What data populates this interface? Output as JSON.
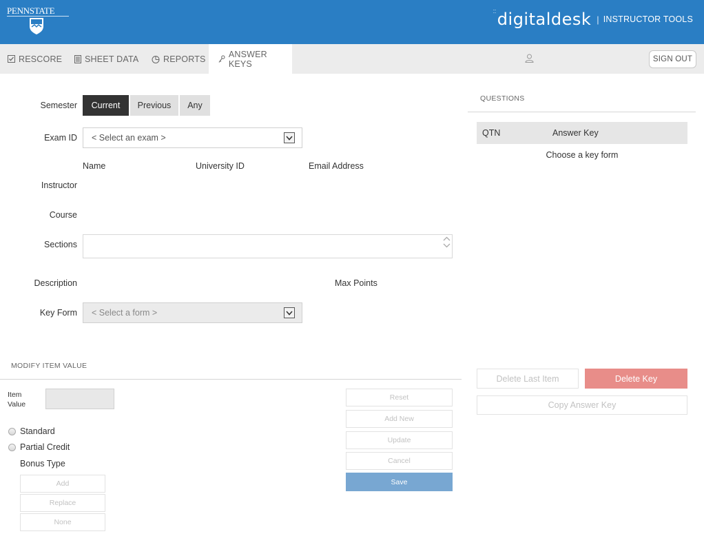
{
  "header": {
    "university": "PENNSTATE",
    "brand_name": "digitaldesk",
    "brand_sep": "|",
    "brand_sub": "INSTRUCTOR TOOLS"
  },
  "nav": {
    "tabs": [
      {
        "label": "RESCORE",
        "icon": "checkbox-icon"
      },
      {
        "label": "SHEET DATA",
        "icon": "document-icon"
      },
      {
        "label": "REPORTS",
        "icon": "pie-chart-icon"
      },
      {
        "label": "ANSWER KEYS",
        "icon": "key-icon",
        "active": true
      }
    ],
    "signout": "SIGN OUT"
  },
  "form": {
    "semester_label": "Semester",
    "semester_options": [
      "Current",
      "Previous",
      "Any"
    ],
    "semester_selected": "Current",
    "exam_label": "Exam ID",
    "exam_value": "< Select an exam >",
    "columns": [
      "Name",
      "University ID",
      "Email Address"
    ],
    "instructor_label": "Instructor",
    "course_label": "Course",
    "sections_label": "Sections",
    "description_label": "Description",
    "max_points_label": "Max Points",
    "keyform_label": "Key Form",
    "keyform_value": "< Select a form >"
  },
  "questions": {
    "title": "QUESTIONS",
    "col_qtn": "QTN",
    "col_key": "Answer Key",
    "empty": "Choose a key form",
    "delete_last": "Delete Last Item",
    "delete_key": "Delete Key",
    "copy_key": "Copy Answer Key"
  },
  "modify": {
    "title": "MODIFY ITEM VALUE",
    "item_label_1": "Item",
    "item_label_2": "Value",
    "radio_standard": "Standard",
    "radio_partial": "Partial Credit",
    "bonus_label": "Bonus Type",
    "bonus_buttons": [
      "Add",
      "Replace",
      "None"
    ],
    "actions": [
      "Reset",
      "Add New",
      "Update",
      "Cancel"
    ],
    "save": "Save"
  },
  "colors": {
    "header_blue": "#2a7ec4",
    "danger": "#e88d89",
    "save_blue": "#78a7d2",
    "active_segment": "#333333"
  }
}
